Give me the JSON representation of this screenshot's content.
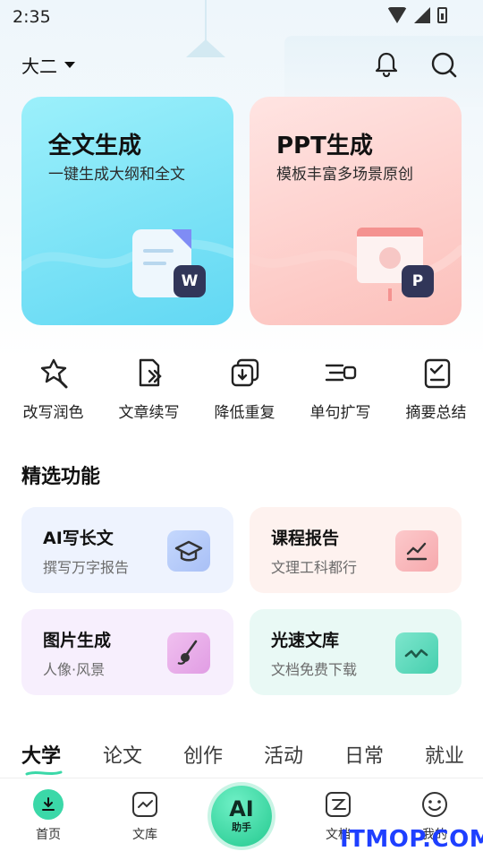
{
  "status_bar": {
    "time": "2:35"
  },
  "header": {
    "grade_label": "大二"
  },
  "big_cards": [
    {
      "title": "全文生成",
      "subtitle": "一键生成大纲和全文",
      "badge": "W"
    },
    {
      "title": "PPT生成",
      "subtitle": "模板丰富多场景原创",
      "badge": "P"
    }
  ],
  "tools": [
    {
      "label": "改写润色",
      "icon": "rewrite-icon"
    },
    {
      "label": "文章续写",
      "icon": "continue-writing-icon"
    },
    {
      "label": "降低重复",
      "icon": "reduce-duplicate-icon"
    },
    {
      "label": "单句扩写",
      "icon": "expand-sentence-icon"
    },
    {
      "label": "摘要总结",
      "icon": "summary-icon"
    }
  ],
  "featured": {
    "title": "精选功能",
    "items": [
      {
        "title": "AI写长文",
        "subtitle": "撰写万字报告"
      },
      {
        "title": "课程报告",
        "subtitle": "文理工科都行"
      },
      {
        "title": "图片生成",
        "subtitle": "人像·风景"
      },
      {
        "title": "光速文库",
        "subtitle": "文档免费下载"
      }
    ]
  },
  "tabs": [
    "大学",
    "论文",
    "创作",
    "活动",
    "日常",
    "就业"
  ],
  "bottom_nav": {
    "home": "首页",
    "library": "文库",
    "ai_main": "AI",
    "ai_sub": "助手",
    "docs": "文档",
    "mine": "我的"
  },
  "watermark": "ITMOP.COM",
  "colors": {
    "accent_green": "#3bd8a8",
    "full_card": "#62d8f3",
    "ppt_card": "#fcc0bb",
    "badge": "#313659"
  }
}
